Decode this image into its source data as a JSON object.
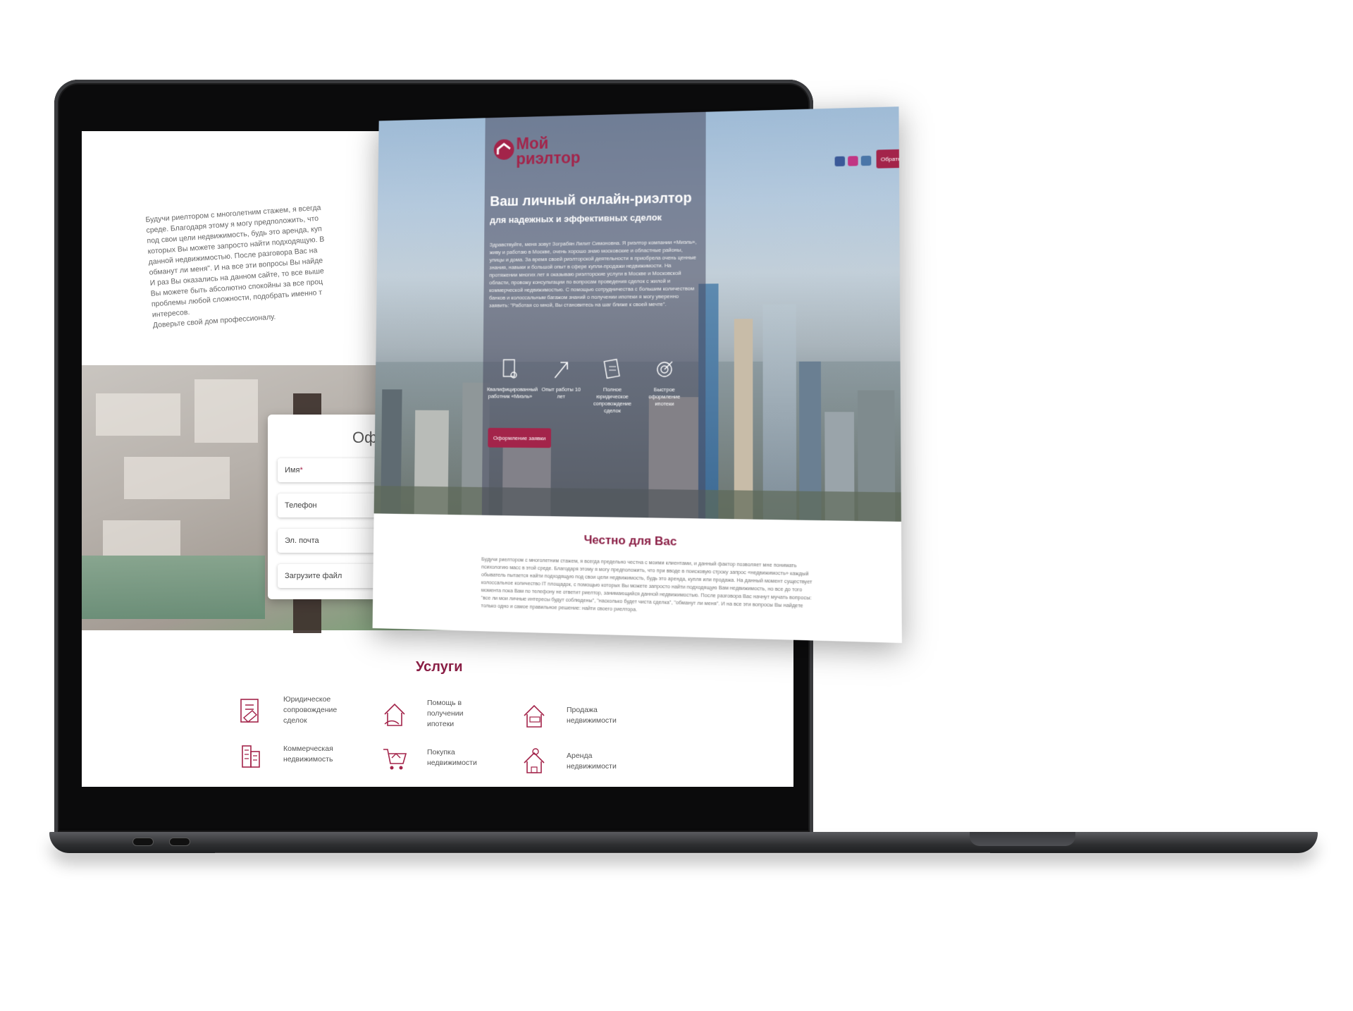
{
  "back_page": {
    "intro_lines": [
      "Будучи риелтором с многолетним стажем, я всегда",
      "среде. Благодаря этому я могу предположить, что",
      "под свои цели недвижимость, будь это аренда, куп",
      "которых Вы можете запросто найти подходящую. В",
      "данной недвижимостью. После разговора Вас на",
      "обманут ли меня\". И на все эти вопросы Вы найде",
      "И раз Вы оказались на данном сайте, то все выше",
      "Вы можете быть абсолютно спокойны за все проц",
      "проблемы любой сложности, подобрать именно т",
      "интересов.",
      "Доверьте свой дом профессионалу."
    ],
    "form": {
      "title": "Оф",
      "name_label": "Имя",
      "required_mark": "*",
      "phone_label": "Телефон",
      "email_label": "Эл. почта",
      "file_label": "Загрузите файл"
    },
    "services_title": "Услуги",
    "services": [
      {
        "label": "Юридическое сопровождение сделок",
        "icon": "legal-doc-icon"
      },
      {
        "label": "Помощь в получении ипотеки",
        "icon": "mortgage-house-icon"
      },
      {
        "label": "Продажа недвижимости",
        "icon": "sale-house-icon"
      },
      {
        "label": "Коммерческая недвижимость",
        "icon": "office-building-icon"
      },
      {
        "label": "Покупка недвижимости",
        "icon": "cart-house-icon"
      },
      {
        "label": "Аренда недвижимости",
        "icon": "key-house-icon"
      }
    ]
  },
  "front_page": {
    "logo_line1": "Мой",
    "logo_line2": "риэлтор",
    "hero_title": "Ваш личный онлайн-риэлтор",
    "hero_subtitle": "для надежных и эффективных сделок",
    "hero_body": "Здравствуйте, меня зовут Зограбян Лилит Симоновна. Я риэлтор компании «Миэль», живу и работаю в Москве, очень хорошо знаю московские и областные районы, улицы и дома. За время своей риэлторской деятельности я приобрела очень ценные знания, навыки и большой опыт в сфере купли-продажи недвижимости. На протяжении многих лет я оказываю риэлторские услуги в Москве и Московской области, провожу консультации по вопросам проведения сделок с жилой и коммерческой недвижимостью. С помощью сотрудничества с большим количеством банков и колоссальным багажом знаний о получении ипотеки я могу уверенно заявить: \"Работая со мной, Вы становитесь на шаг ближе к своей мечте\".",
    "features": [
      {
        "label": "Квалифицированный работник «Миэль»",
        "icon": "document-pin-icon"
      },
      {
        "label": "Опыт работы 10 лет",
        "icon": "arrow-up-icon"
      },
      {
        "label": "Полное юридическое сопровождение сделок",
        "icon": "contract-icon"
      },
      {
        "label": "Быстрое оформление ипотеки",
        "icon": "target-icon"
      }
    ],
    "cta_label": "Оформление заявки",
    "callback_label": "Обратная св",
    "social": [
      {
        "name": "facebook",
        "color": "#3b5998"
      },
      {
        "name": "instagram",
        "color": "#c13584"
      },
      {
        "name": "vk",
        "color": "#4a76a8"
      }
    ],
    "honest_title": "Честно для Вас",
    "honest_body": "Будучи риелтором с многолетним стажем, я всегда предельно честна с моими клиентами, и данный фактор позволяет мне понимать психологию масс в этой среде. Благодаря этому я могу предположить, что при вводе в поисковую строку запрос «недвижимость» каждый обыватель пытается найти подходящую под свои цели недвижимость, будь это аренда, купля или продажа. На данный момент существует колоссальное количество IT площадок, с помощью которых Вы можете запросто найти подходящую Вам недвижимость, но все до того момента пока Вам по телефону не ответит риелтор, занимающийся данной недвижимостью. После разговора Вас начнут мучать вопросы: \"все ли мои личные интересы будут соблюдены\", \"насколько будет чиста сделка\", \"обманут ли меня\". И на все эти вопросы Вы найдете только одно и самое правильное решение: найти своего риелтора."
  },
  "colors": {
    "accent": "#a3244a",
    "accent_dark": "#8a1e45",
    "laptop_body": "#3a3b3e"
  }
}
